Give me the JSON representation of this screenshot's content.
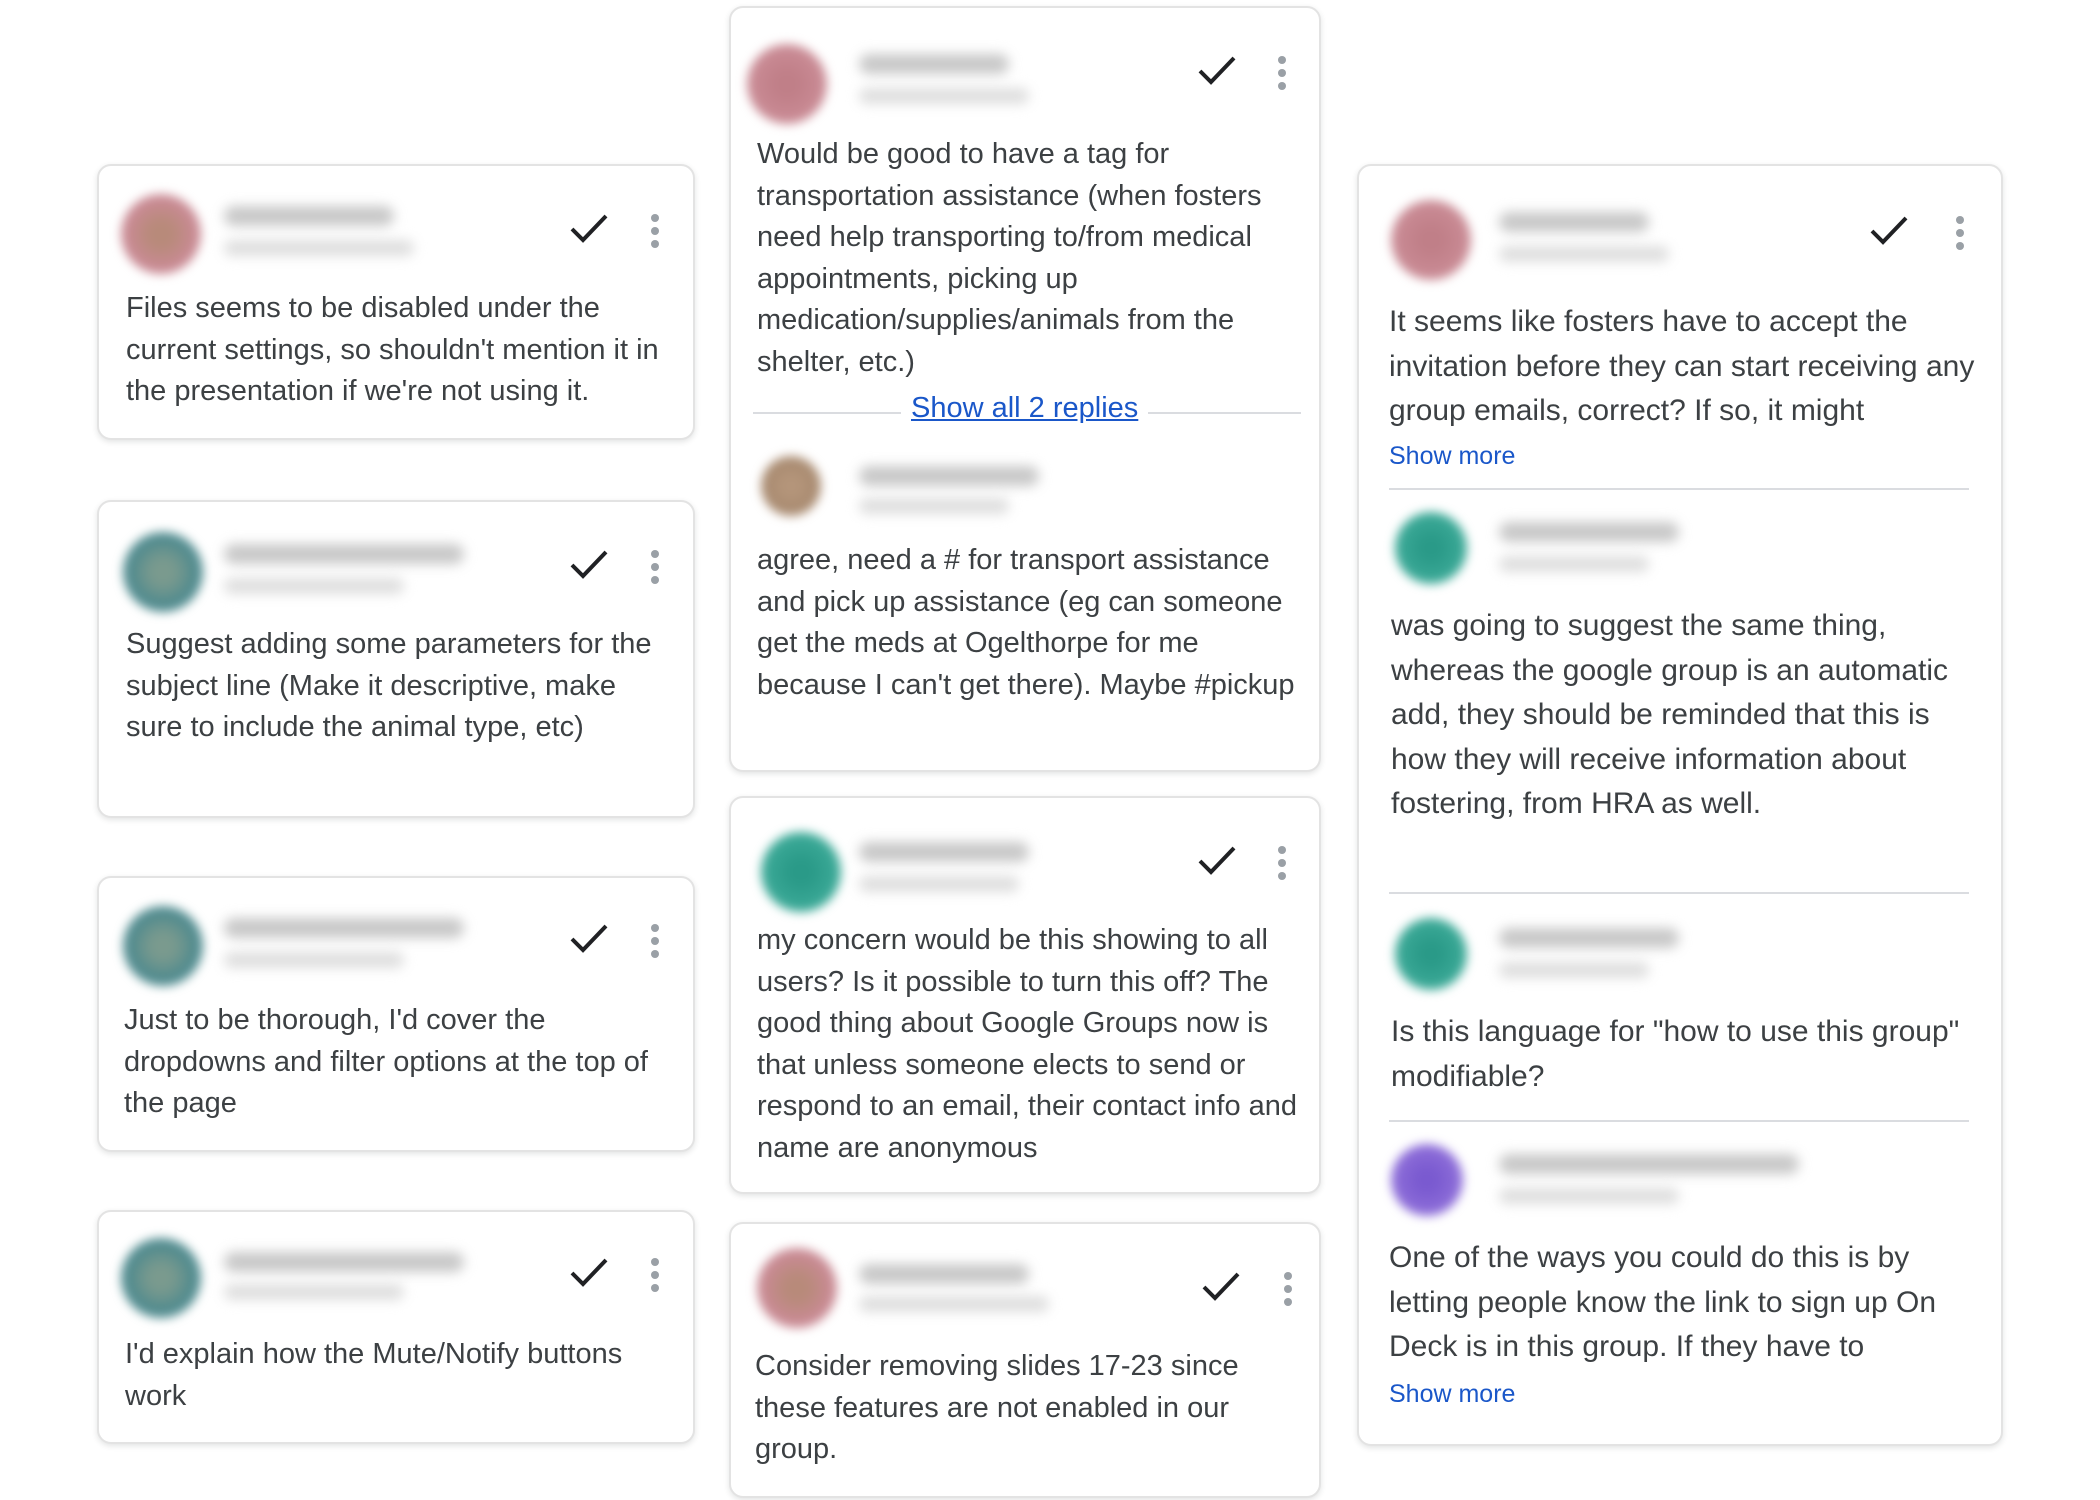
{
  "colors": {
    "link": "#1a57c9",
    "text": "#3c4043",
    "avatar_pink": "#c98a94",
    "avatar_teal": "#3aa896",
    "avatar_blue": "#5a8a8c",
    "avatar_brown": "#a88a70",
    "avatar_purple": "#8c6cd8"
  },
  "icons": {
    "resolve": "checkmark-icon",
    "more": "more-vert-icon"
  },
  "column_left": {
    "comments": [
      {
        "text": "Files seems to be disabled under the current settings, so shouldn't mention it in the presentation if we're not using it."
      },
      {
        "text": "Suggest adding some parameters for the subject line (Make it descriptive, make sure to include the animal type, etc)"
      },
      {
        "text": "Just to be thorough, I'd cover the dropdowns and filter options at the top of the page"
      },
      {
        "text": "I'd explain how the Mute/Notify buttons work"
      }
    ]
  },
  "column_middle": {
    "thread1": {
      "text": "Would be good to have a tag for transportation assistance (when fosters need help transporting to/from medical appointments, picking up medication/supplies/animals from the shelter, etc.)",
      "show_replies": "Show all 2 replies",
      "reply_text": "agree, need a # for transport assistance and pick up assistance (eg can someone get the meds at Ogelthorpe for me because I can't get there). Maybe #pickup"
    },
    "thread2": {
      "text": "my concern would be this showing to all users? Is it possible to turn this off? The good thing about Google Groups now is that unless someone elects to send or respond to an email, their contact info and name are anonymous"
    },
    "thread3": {
      "text": "Consider removing slides 17-23 since these features are not enabled in our group."
    }
  },
  "column_right": {
    "thread": {
      "text": "It seems like fosters have to accept the invitation before they can start receiving any group emails, correct? If so, it might",
      "show_more": "Show more",
      "replies": [
        {
          "text": "was going to suggest the same thing, whereas the google group is an automatic add, they should be reminded that this is how they will receive information about fostering, from HRA as well."
        },
        {
          "text": "Is this language for \"how to use this group\" modifiable?"
        },
        {
          "text": "One of the ways you could do this is by letting people know the link to sign up On Deck is in this group. If they have to",
          "show_more": "Show more"
        }
      ]
    }
  }
}
